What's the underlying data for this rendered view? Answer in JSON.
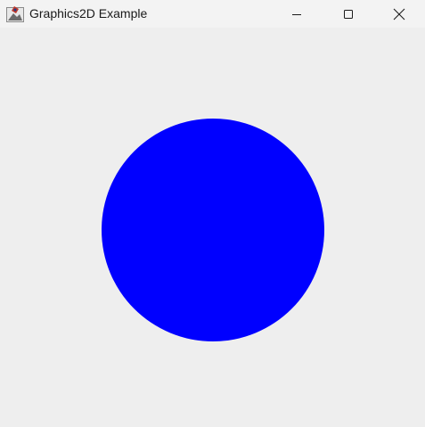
{
  "window": {
    "title": "Graphics2D Example",
    "icon": "java-app-icon",
    "controls": {
      "minimize_icon": "minimize-icon",
      "maximize_icon": "maximize-icon",
      "close_icon": "close-icon"
    }
  },
  "canvas": {
    "background_color": "#eeeeee",
    "shape": {
      "type": "circle",
      "fill_color": "#0000ff"
    }
  }
}
